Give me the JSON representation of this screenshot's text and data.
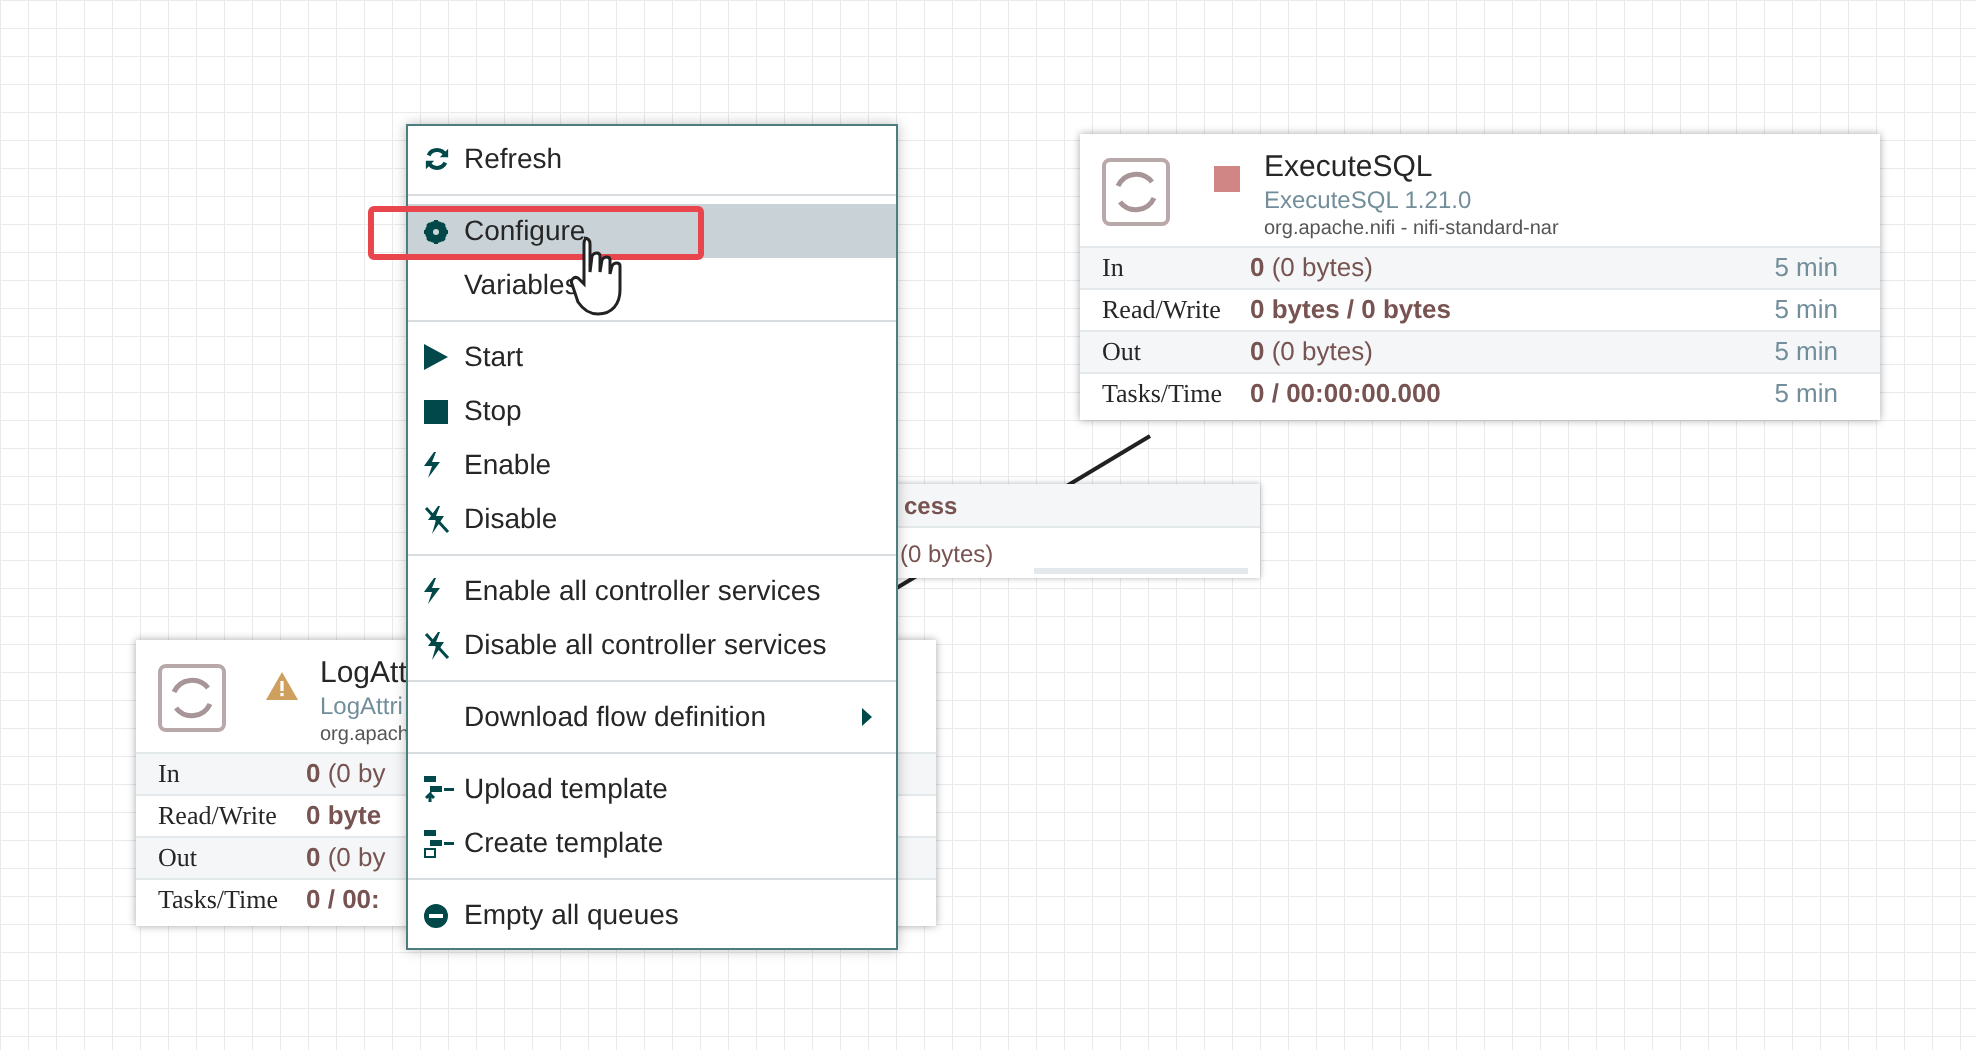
{
  "processors": [
    {
      "stopped": true,
      "invalid": false,
      "name": "ExecuteSQL",
      "type": "ExecuteSQL 1.21.0",
      "bundle": "org.apache.nifi - nifi-standard-nar",
      "stats": [
        {
          "label": "In",
          "value": "**0** (0 bytes)",
          "time": "5 min"
        },
        {
          "label": "Read/Write",
          "value": "**0 bytes / 0 bytes**",
          "time": "5 min"
        },
        {
          "label": "Out",
          "value": "**0** (0 bytes)",
          "time": "5 min"
        },
        {
          "label": "Tasks/Time",
          "value": "**0 / 00:00:00.000**",
          "time": "5 min"
        }
      ]
    },
    {
      "stopped": false,
      "invalid": true,
      "name": "LogAtt",
      "type": "LogAttri",
      "bundle": "org.apach",
      "stats": [
        {
          "label": "In",
          "value": "**0** (0 by"
        },
        {
          "label": "Read/Write",
          "value": "**0 byte**"
        },
        {
          "label": "Out",
          "value": "**0** (0 by"
        },
        {
          "label": "Tasks/Time",
          "value": "**0 / 00:**"
        }
      ]
    }
  ],
  "connection": {
    "name": "cess",
    "queued": "(0 bytes)"
  },
  "context_menu": [
    {
      "kind": "item",
      "label": "Refresh",
      "selected": false
    },
    {
      "kind": "separator"
    },
    {
      "kind": "item",
      "label": "Configure",
      "selected": true
    },
    {
      "kind": "item",
      "label": "Variables",
      "selected": false
    },
    {
      "kind": "separator"
    },
    {
      "kind": "item",
      "label": "Start",
      "selected": false
    },
    {
      "kind": "item",
      "label": "Stop",
      "selected": false
    },
    {
      "kind": "item",
      "label": "Enable",
      "selected": false
    },
    {
      "kind": "item",
      "label": "Disable",
      "selected": false
    },
    {
      "kind": "separator"
    },
    {
      "kind": "item",
      "label": "Enable all controller services",
      "selected": false
    },
    {
      "kind": "item",
      "label": "Disable all controller services",
      "selected": false
    },
    {
      "kind": "separator"
    },
    {
      "kind": "item",
      "label": "Download flow definition",
      "selected": false,
      "submenu": true
    },
    {
      "kind": "separator"
    },
    {
      "kind": "item",
      "label": "Upload template",
      "selected": false
    },
    {
      "kind": "item",
      "label": "Create template",
      "selected": false
    },
    {
      "kind": "separator"
    },
    {
      "kind": "item",
      "label": "Empty all queues",
      "selected": false
    }
  ]
}
